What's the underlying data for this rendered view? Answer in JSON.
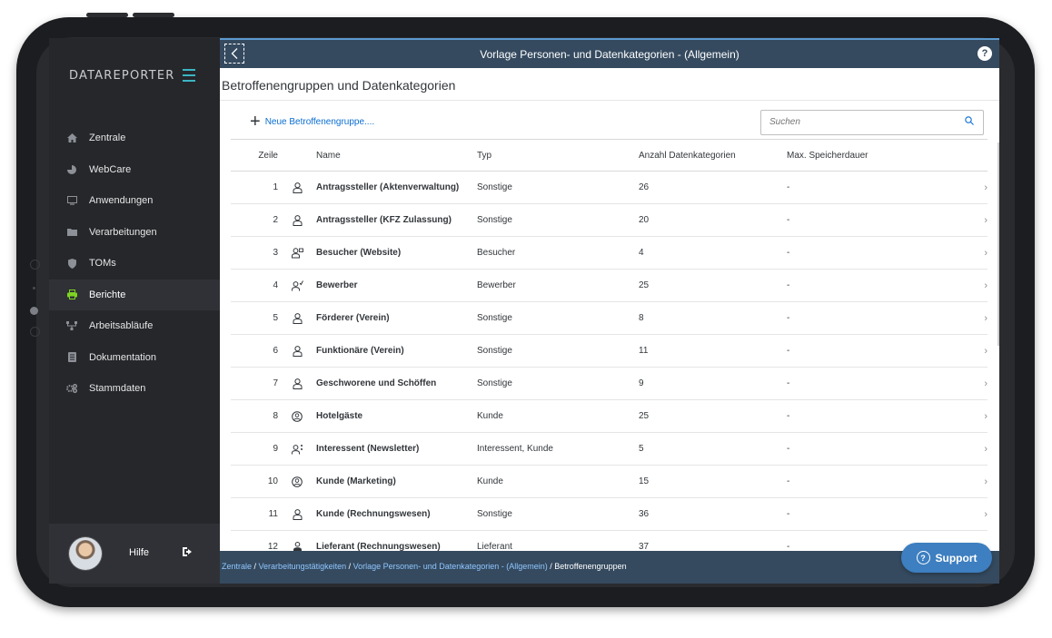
{
  "sidebar": {
    "logo": "DATAREPORTER",
    "items": [
      {
        "label": "Zentrale",
        "icon": "home-icon"
      },
      {
        "label": "WebCare",
        "icon": "pie-chart-icon"
      },
      {
        "label": "Anwendungen",
        "icon": "monitor-icon"
      },
      {
        "label": "Verarbeitungen",
        "icon": "folder-icon"
      },
      {
        "label": "TOMs",
        "icon": "shield-icon"
      },
      {
        "label": "Berichte",
        "icon": "printer-icon"
      },
      {
        "label": "Arbeitsabläufe",
        "icon": "workflow-icon"
      },
      {
        "label": "Dokumentation",
        "icon": "document-icon"
      },
      {
        "label": "Stammdaten",
        "icon": "gears-icon"
      }
    ],
    "user": {
      "label": "Hilfe"
    }
  },
  "header": {
    "title": "Vorlage Personen- und Datenkategorien - (Allgemein)",
    "help": "?"
  },
  "subheader": {
    "title": "Betroffenengruppen und Datenkategorien"
  },
  "toolbar": {
    "new_label": "Neue Betroffenengruppe....",
    "search_placeholder": "Suchen"
  },
  "table": {
    "columns": [
      "Zeile",
      "Name",
      "Typ",
      "Anzahl Datenkategorien",
      "Max. Speicherdauer"
    ],
    "rows": [
      {
        "zeile": "1",
        "icon": "person-icon",
        "name": "Antragssteller (Aktenverwaltung)",
        "typ": "Sonstige",
        "anzahl": "26",
        "max": "-"
      },
      {
        "zeile": "2",
        "icon": "person-icon",
        "name": "Antragssteller (KFZ Zulassung)",
        "typ": "Sonstige",
        "anzahl": "20",
        "max": "-"
      },
      {
        "zeile": "3",
        "icon": "visitor-icon",
        "name": "Besucher (Website)",
        "typ": "Besucher",
        "anzahl": "4",
        "max": "-"
      },
      {
        "zeile": "4",
        "icon": "applicant-icon",
        "name": "Bewerber",
        "typ": "Bewerber",
        "anzahl": "25",
        "max": "-"
      },
      {
        "zeile": "5",
        "icon": "person-icon",
        "name": "Förderer (Verein)",
        "typ": "Sonstige",
        "anzahl": "8",
        "max": "-"
      },
      {
        "zeile": "6",
        "icon": "person-icon",
        "name": "Funktionäre (Verein)",
        "typ": "Sonstige",
        "anzahl": "11",
        "max": "-"
      },
      {
        "zeile": "7",
        "icon": "person-icon",
        "name": "Geschworene und Schöffen",
        "typ": "Sonstige",
        "anzahl": "9",
        "max": "-"
      },
      {
        "zeile": "8",
        "icon": "customer-icon",
        "name": "Hotelgäste",
        "typ": "Kunde",
        "anzahl": "25",
        "max": "-"
      },
      {
        "zeile": "9",
        "icon": "interested-icon",
        "name": "Interessent (Newsletter)",
        "typ": "Interessent, Kunde",
        "anzahl": "5",
        "max": "-"
      },
      {
        "zeile": "10",
        "icon": "customer-icon",
        "name": "Kunde (Marketing)",
        "typ": "Kunde",
        "anzahl": "15",
        "max": "-"
      },
      {
        "zeile": "11",
        "icon": "person-icon",
        "name": "Kunde (Rechnungswesen)",
        "typ": "Sonstige",
        "anzahl": "36",
        "max": "-"
      },
      {
        "zeile": "12",
        "icon": "supplier-icon",
        "name": "Lieferant (Rechnungswesen)",
        "typ": "Lieferant",
        "anzahl": "37",
        "max": "-"
      }
    ]
  },
  "breadcrumb": {
    "items": [
      "Zentrale",
      "Verarbeitungstätigkeiten",
      "Vorlage Personen- und Datenkategorien - (Allgemein)"
    ],
    "current": "Betroffenengruppen",
    "separator": " / "
  },
  "support": {
    "label": "Support"
  },
  "colors": {
    "sidebar": "#25272b",
    "header": "#354a5f",
    "accent": "#3bb5c4",
    "active_icon": "#7ed321",
    "link": "#0a6ed1",
    "support": "#3d7fc0"
  }
}
